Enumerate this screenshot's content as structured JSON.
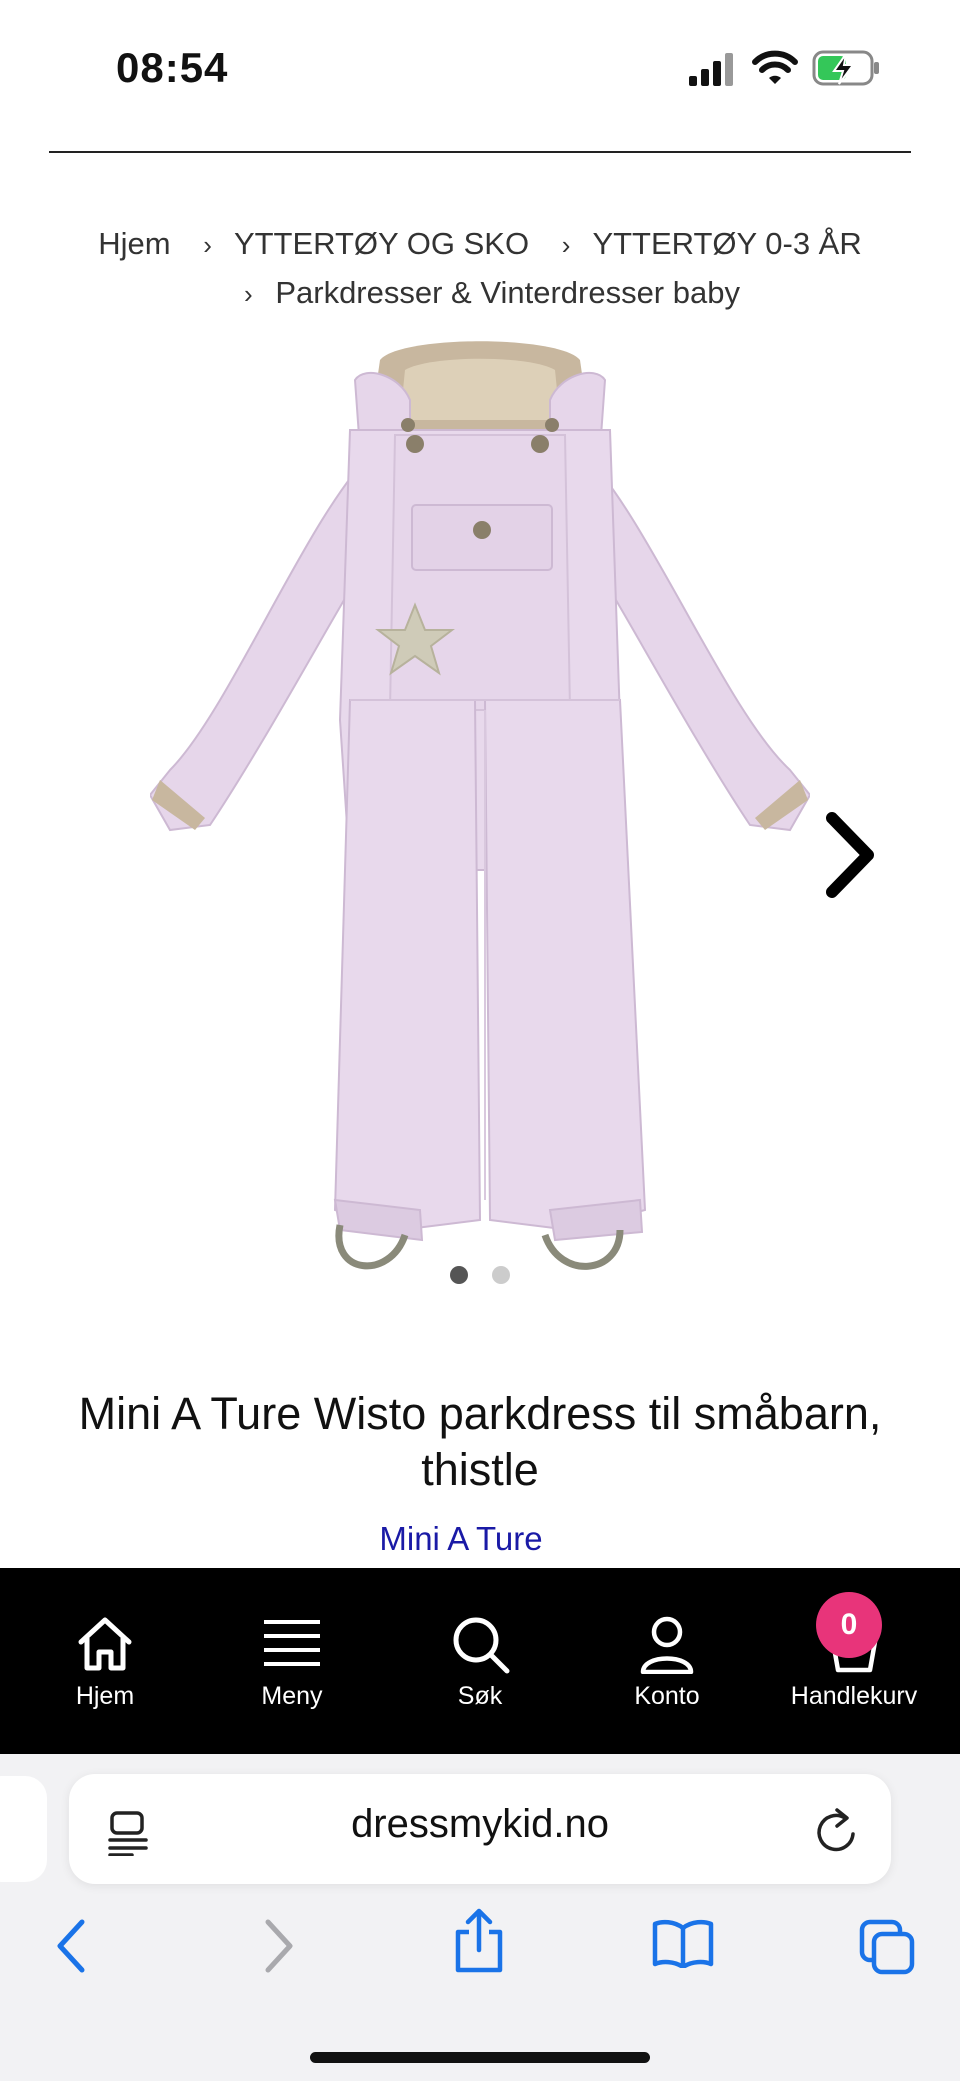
{
  "status_bar": {
    "time": "08:54"
  },
  "breadcrumb": {
    "items": [
      "Hjem",
      "YTTERTØY OG SKO",
      "YTTERTØY 0-3 ÅR",
      "Parkdresser & Vinterdresser baby"
    ]
  },
  "product": {
    "title": "Mini A Ture Wisto parkdress til småbarn, thistle",
    "brand": "Mini A Ture",
    "image_color": "#e6d6ea",
    "gallery": {
      "current": 1,
      "total": 2
    }
  },
  "bottom_nav": {
    "items": [
      {
        "label": "Hjem",
        "icon": "home-icon"
      },
      {
        "label": "Meny",
        "icon": "menu-icon"
      },
      {
        "label": "Søk",
        "icon": "search-icon"
      },
      {
        "label": "Konto",
        "icon": "account-icon"
      },
      {
        "label": "Handlekurv",
        "icon": "cart-icon"
      }
    ],
    "cart_count": "0",
    "badge_color": "#e8347a"
  },
  "browser": {
    "url": "dressmykid.no",
    "accent": "#1a73e8"
  }
}
